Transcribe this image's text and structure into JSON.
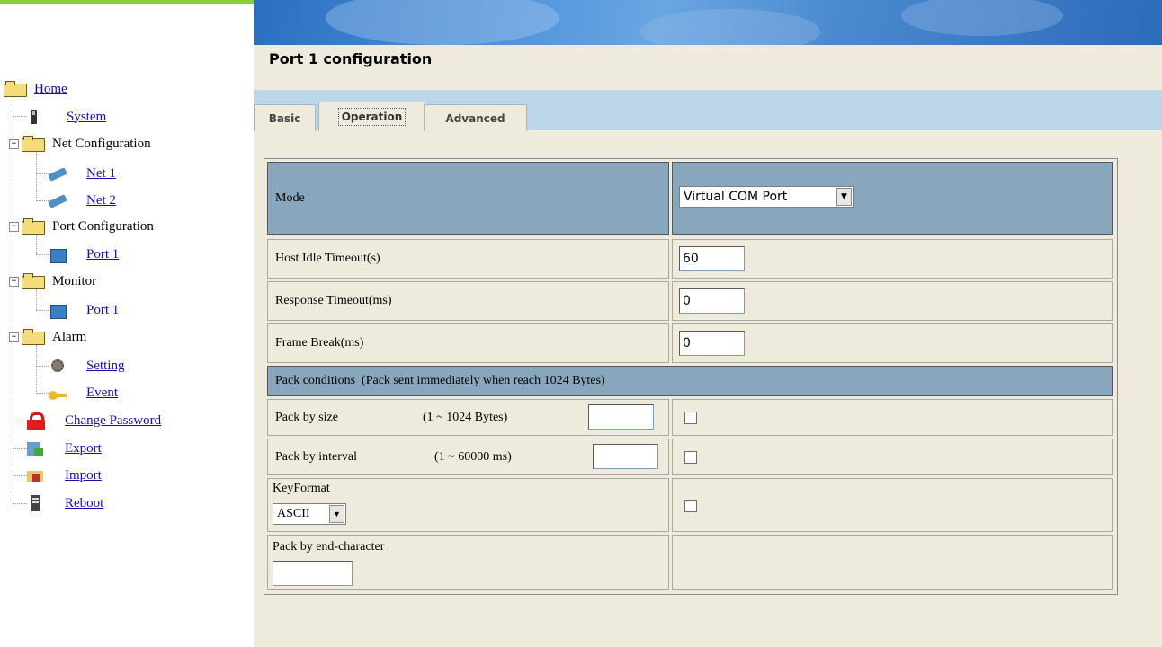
{
  "nav": {
    "items": [
      {
        "label": "Home",
        "link": true,
        "icon": "folder-icon"
      },
      {
        "label": "System",
        "link": true,
        "icon": "server-icon"
      },
      {
        "label": "Net Configuration",
        "link": false,
        "icon": "folder-icon"
      },
      {
        "label": "Net 1",
        "link": true,
        "icon": "network-card-icon"
      },
      {
        "label": "Net 2",
        "link": true,
        "icon": "network-card-icon"
      },
      {
        "label": "Port Configuration",
        "link": false,
        "icon": "folder-icon"
      },
      {
        "label": "Port 1",
        "link": true,
        "icon": "port-icon"
      },
      {
        "label": "Monitor",
        "link": false,
        "icon": "folder-icon"
      },
      {
        "label": "Port 1",
        "link": true,
        "icon": "port-icon"
      },
      {
        "label": "Alarm",
        "link": false,
        "icon": "folder-icon"
      },
      {
        "label": "Setting",
        "link": true,
        "icon": "gear-person-icon"
      },
      {
        "label": "Event",
        "link": true,
        "icon": "key-icon"
      },
      {
        "label": "Change Password",
        "link": true,
        "icon": "lock-icon"
      },
      {
        "label": "Export",
        "link": true,
        "icon": "export-icon"
      },
      {
        "label": "Import",
        "link": true,
        "icon": "import-icon"
      },
      {
        "label": "Reboot",
        "link": true,
        "icon": "reboot-icon"
      }
    ]
  },
  "header": {
    "title": "Port 1 configuration"
  },
  "tabs": [
    {
      "label": "Basic",
      "active": false
    },
    {
      "label": "Operation",
      "active": true
    },
    {
      "label": "Advanced",
      "active": false
    }
  ],
  "config": {
    "mode_label": "Mode",
    "mode_value": "Virtual COM Port",
    "host_idle_label": "Host Idle Timeout(s)",
    "host_idle_value": "60",
    "response_label": "Response Timeout(ms)",
    "response_value": "0",
    "frame_break_label": "Frame Break(ms)",
    "frame_break_value": "0",
    "pack_conditions_label": "Pack conditions  (Pack sent immediately when reach 1024 Bytes)",
    "pack_size_label": "Pack by size",
    "pack_size_range": "(1 ~ 1024 Bytes)",
    "pack_size_value": "",
    "pack_interval_label": "Pack by interval",
    "pack_interval_range": "(1 ~ 60000 ms)",
    "pack_interval_value": "",
    "keyformat_label": "KeyFormat",
    "keyformat_value": "ASCII",
    "pack_end_label": "Pack by end-character",
    "pack_end_value": ""
  },
  "colors": {
    "header_cell": "#88a7bd",
    "panel_bg": "#eeebdd",
    "tabbar_bg": "#bcd7ea"
  }
}
